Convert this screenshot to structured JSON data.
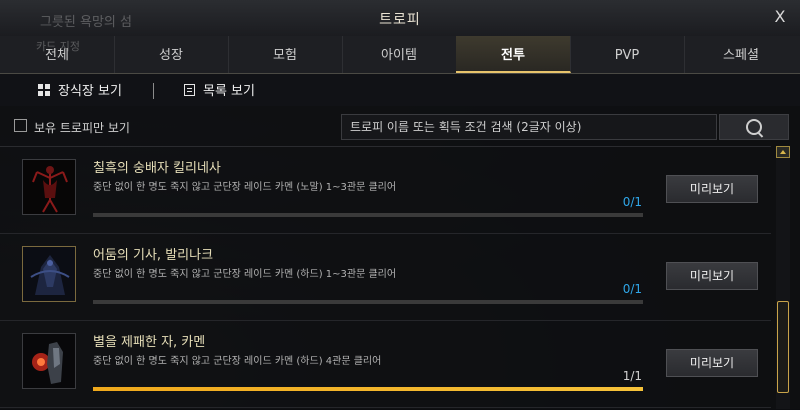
{
  "background": {
    "ghost_text_1": "그릇된 욕망의 섬",
    "ghost_text_2": "카드 지정"
  },
  "window": {
    "title": "트로피",
    "close_label": "X"
  },
  "tabs": [
    {
      "label": "전체"
    },
    {
      "label": "성장"
    },
    {
      "label": "모험"
    },
    {
      "label": "아이템"
    },
    {
      "label": "전투"
    },
    {
      "label": "PVP"
    },
    {
      "label": "스페셜"
    }
  ],
  "active_tab": "전투",
  "view_toggle": {
    "decoration_view": "장식장 보기",
    "list_view": "목록 보기"
  },
  "filter": {
    "owned_only_label": "보유 트로피만 보기",
    "owned_only_checked": false,
    "search_placeholder": "트로피 이름 또는 획득 조건 검색 (2글자 이상)"
  },
  "trophies": [
    {
      "name": "칠흑의 숭배자 킬리네사",
      "description": "중단 없이 한 명도 죽지 않고 군단장 레이드 카멘 (노말) 1~3관문 클리어",
      "progress_text": "0/1",
      "progress": 0,
      "button": "미리보기"
    },
    {
      "name": "어둠의 기사, 발리나크",
      "description": "중단 없이 한 명도 죽지 않고 군단장 레이드 카멘 (하드) 1~3관문 클리어",
      "progress_text": "0/1",
      "progress": 0,
      "button": "미리보기"
    },
    {
      "name": "별을 제패한 자, 카멘",
      "description": "중단 없이 한 명도 죽지 않고 군단장 레이드 카멘 (하드) 4관문 클리어",
      "progress_text": "1/1",
      "progress": 1,
      "button": "미리보기"
    }
  ],
  "colors": {
    "accent_gold": "#e8c46b",
    "progress_blue": "#2fa6e8",
    "progress_fill": "#f0a91c"
  }
}
